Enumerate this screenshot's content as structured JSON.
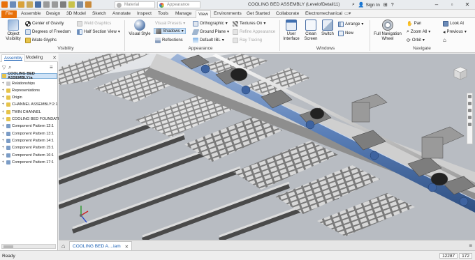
{
  "title_bar": {
    "material_label": "Material",
    "appearance_label": "Appearance",
    "document_title": "COOLING BED ASSEMBLY (LevelofDetail11)",
    "sign_in_label": "Sign In"
  },
  "tabs": {
    "file": "File",
    "items": [
      "Assemble",
      "Design",
      "3D Model",
      "Sketch",
      "Annotate",
      "Inspect",
      "Tools",
      "Manage",
      "View",
      "Environments",
      "Get Started",
      "Collaborate",
      "Electromechanical"
    ],
    "active": "View"
  },
  "ribbon": {
    "visibility": {
      "object_visibility": "Object Visibility",
      "center_of_gravity": "Center of Gravity",
      "degrees_of_freedom": "Degrees of Freedom",
      "imate_glyphs": "iMate Glyphs",
      "weld_graphics": "Weld Graphics",
      "half_section_view": "Half Section View",
      "group_label": "Visibility"
    },
    "appearance": {
      "visual_style": "Visual Style",
      "visual_presets": "Visual Presets",
      "shadows": "Shadows",
      "reflections": "Reflections",
      "orthographic": "Orthographic",
      "ground_plane": "Ground Plane",
      "default_ibl": "Default IBL",
      "textures_on": "Textures On",
      "refine_appearance": "Refine Appearance",
      "ray_tracing": "Ray Tracing",
      "group_label": "Appearance"
    },
    "windows": {
      "user_interface": "User Interface",
      "clean_screen": "Clean Screen",
      "switch": "Switch",
      "arrange": "Arrange",
      "new": "New",
      "group_label": "Windows"
    },
    "navigate": {
      "full_navigation_wheel": "Full Navigation Wheel",
      "pan": "Pan",
      "zoom_all": "Zoom All",
      "orbit": "Orbit",
      "look_at": "Look At",
      "previous": "Previous",
      "group_label": "Navigate"
    }
  },
  "browser": {
    "tabs": [
      "Assembly",
      "Modeling"
    ],
    "root": "COOLING BED ASSEMBLY.ia",
    "items": [
      {
        "label": "Relationships",
        "icon": "relationships-icon"
      },
      {
        "label": "Representations",
        "icon": "folder-icon"
      },
      {
        "label": "Origin",
        "icon": "folder-icon"
      },
      {
        "label": "CHANNEL ASSEMBLY:2:1",
        "icon": "part-icon"
      },
      {
        "label": "TWIN CHANNEL",
        "icon": "part-icon"
      },
      {
        "label": "COOLING BED FOUNDATI",
        "icon": "part-icon"
      },
      {
        "label": "Component Pattern 12:1",
        "icon": "pattern-icon"
      },
      {
        "label": "Component Pattern 13:1",
        "icon": "pattern-icon"
      },
      {
        "label": "Component Pattern 14:1",
        "icon": "pattern-icon"
      },
      {
        "label": "Component Pattern 15:1",
        "icon": "pattern-icon"
      },
      {
        "label": "Component Pattern 16:1",
        "icon": "pattern-icon"
      },
      {
        "label": "Component Pattern 17:1",
        "icon": "pattern-icon"
      }
    ]
  },
  "document_tab": {
    "label": "COOLING BED A....iam"
  },
  "status_bar": {
    "ready": "Ready",
    "count1": "12287",
    "count2": "172"
  },
  "colors": {
    "file_tab": "#e8710a",
    "accent": "#1a5fb4",
    "shaft_blue": "#5a7fb8"
  }
}
